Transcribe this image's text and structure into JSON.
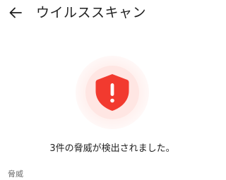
{
  "header": {
    "back_icon": "arrow-left-icon",
    "title": "ウイルススキャン"
  },
  "scan": {
    "icon": "shield-alert-icon",
    "accent_color": "#f23a2f",
    "status_text": "3件の脅威が検出されました。",
    "threat_count": 3
  },
  "threats_section": {
    "label": "脅威"
  }
}
